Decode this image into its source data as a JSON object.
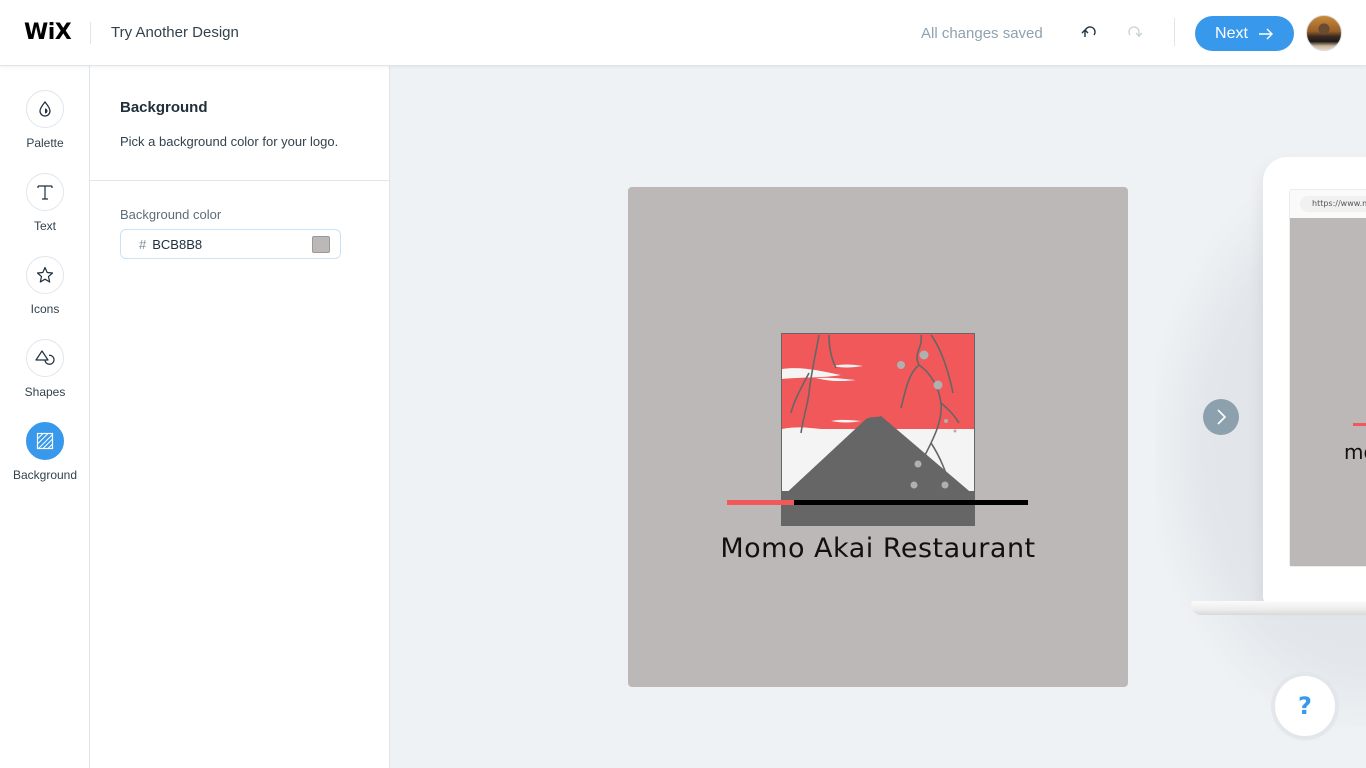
{
  "header": {
    "logo_text": "WiX",
    "title": "Try Another Design",
    "status": "All changes saved",
    "undo_icon": "undo-icon",
    "redo_icon": "redo-icon",
    "next_label": "Next",
    "next_icon": "arrow-right-icon",
    "avatar": "user-avatar"
  },
  "rail": {
    "items": [
      {
        "label": "Palette",
        "icon": "palette-drop-icon",
        "active": false
      },
      {
        "label": "Text",
        "icon": "text-t-icon",
        "active": false
      },
      {
        "label": "Icons",
        "icon": "star-icon",
        "active": false
      },
      {
        "label": "Shapes",
        "icon": "shapes-icon",
        "active": false
      },
      {
        "label": "Background",
        "icon": "background-hatch-icon",
        "active": true
      }
    ]
  },
  "panel": {
    "title": "Background",
    "description": "Pick a background color for your logo.",
    "field_label": "Background color",
    "hash": "#",
    "color_value": "BCB8B8",
    "swatch_color": "#BCB8B8"
  },
  "canvas": {
    "logo_background": "#BCB8B8",
    "brand_name": "Momo Akai Restaurant",
    "accent_red": "#F0585A",
    "next_design_icon": "chevron-right-icon",
    "preview_url": "https://www.m",
    "preview_text": "mo",
    "help_label": "?"
  },
  "colors": {
    "primary": "#3899EC",
    "art_red": "#F0585A",
    "art_gray": "#666666",
    "art_white": "#F4F4F4"
  }
}
